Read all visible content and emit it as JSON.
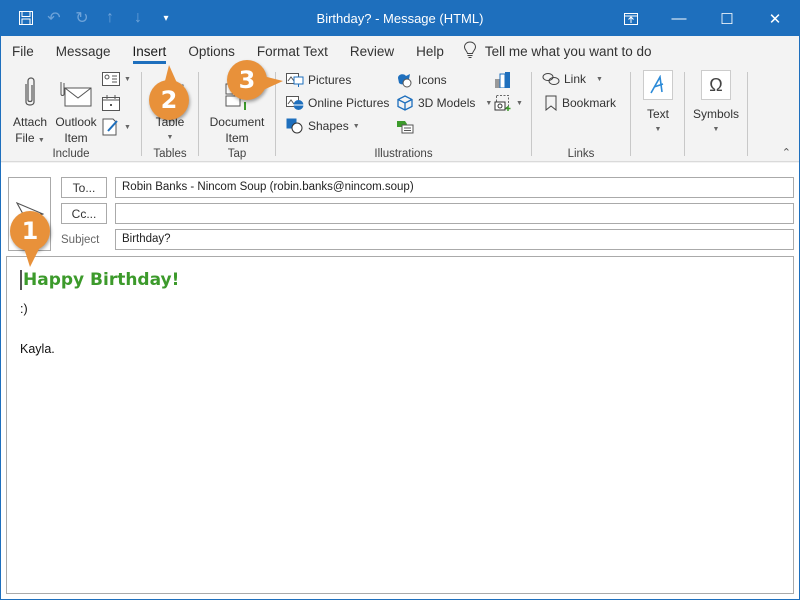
{
  "titlebar": {
    "title": "Birthday? - Message (HTML)",
    "qat": [
      "save-icon",
      "undo-icon",
      "redo-icon",
      "up-icon",
      "down-icon",
      "customize-icon"
    ]
  },
  "tabs": [
    {
      "label": "File"
    },
    {
      "label": "Message"
    },
    {
      "label": "Insert",
      "active": true
    },
    {
      "label": "Options"
    },
    {
      "label": "Format Text"
    },
    {
      "label": "Review"
    },
    {
      "label": "Help"
    }
  ],
  "tell_me": "Tell me what you want to do",
  "ribbon": {
    "include": {
      "label": "Include",
      "attach_file": "Attach\nFile",
      "attach_line1": "Attach",
      "attach_line2": "File",
      "outlook_line1": "Outlook",
      "outlook_line2": "Item"
    },
    "tables": {
      "label": "Tables",
      "table": "Table"
    },
    "tap": {
      "label": "Tap",
      "doc_line1": "Document",
      "doc_line2": "Item"
    },
    "illustrations": {
      "label": "Illustrations",
      "pictures": "Pictures",
      "online_pictures": "Online Pictures",
      "shapes": "Shapes",
      "icons": "Icons",
      "models": "3D Models"
    },
    "links": {
      "label": "Links",
      "link": "Link",
      "bookmark": "Bookmark"
    },
    "text": {
      "label": "Text"
    },
    "symbols": {
      "label": "Symbols"
    }
  },
  "callouts": {
    "one": "1",
    "two": "2",
    "three": "3"
  },
  "colors": {
    "accent": "#1e6fbd",
    "callout": "#e8913a",
    "greeting": "#3c9a2b"
  },
  "compose": {
    "to_label": "To...",
    "cc_label": "Cc...",
    "subject_label": "Subject",
    "to_value": "Robin Banks - Nincom Soup (robin.banks@nincom.soup)",
    "cc_value": "",
    "subject_value": "Birthday?",
    "body": {
      "greeting": "Happy Birthday!",
      "line1": ":)",
      "signature": "Kayla."
    }
  }
}
